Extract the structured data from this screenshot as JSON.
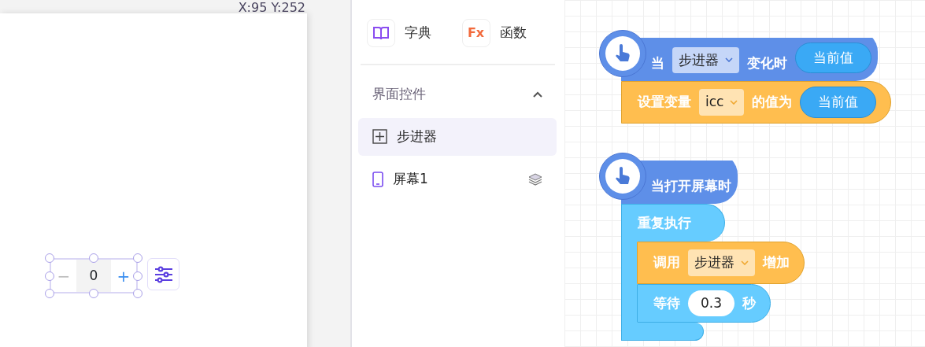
{
  "coordinates": "X:95 Y:252",
  "stepper": {
    "minus": "−",
    "value": "0",
    "plus": "+",
    "selected": true
  },
  "palette": [
    {
      "label": "字典",
      "kind": "dictionary"
    },
    {
      "label": "函数",
      "kind": "function",
      "icon_text": "Fx"
    }
  ],
  "section": {
    "title": "界面控件",
    "expanded": true
  },
  "components": [
    {
      "label": "步进器",
      "kind": "stepper",
      "selected": true
    },
    {
      "label": "屏幕1",
      "kind": "screen",
      "selected": false
    }
  ],
  "scripts": [
    {
      "hat": {
        "parts": [
          {
            "kind": "text",
            "text": "当"
          },
          {
            "kind": "dropdown",
            "text": "步进器"
          },
          {
            "kind": "text",
            "text": "变化时"
          },
          {
            "kind": "reporter",
            "text": "当前值"
          }
        ]
      },
      "body": [
        {
          "kind": "action",
          "parts": [
            {
              "kind": "text",
              "text": "设置变量"
            },
            {
              "kind": "dropdown",
              "text": "icc"
            },
            {
              "kind": "text",
              "text": "的值为"
            },
            {
              "kind": "reporter",
              "text": "当前值"
            }
          ]
        }
      ]
    },
    {
      "hat": {
        "parts": [
          {
            "kind": "text",
            "text": "当打开屏幕时"
          }
        ]
      },
      "body": [
        {
          "kind": "loop",
          "parts": [
            {
              "kind": "text",
              "text": "重复执行"
            }
          ],
          "children": [
            {
              "kind": "action",
              "parts": [
                {
                  "kind": "text",
                  "text": "调用"
                },
                {
                  "kind": "dropdown",
                  "text": "步进器"
                },
                {
                  "kind": "text",
                  "text": "增加"
                }
              ]
            },
            {
              "kind": "control",
              "parts": [
                {
                  "kind": "text",
                  "text": "等待"
                },
                {
                  "kind": "number",
                  "text": "0.3"
                },
                {
                  "kind": "text",
                  "text": "秒"
                }
              ]
            }
          ]
        }
      ]
    }
  ]
}
